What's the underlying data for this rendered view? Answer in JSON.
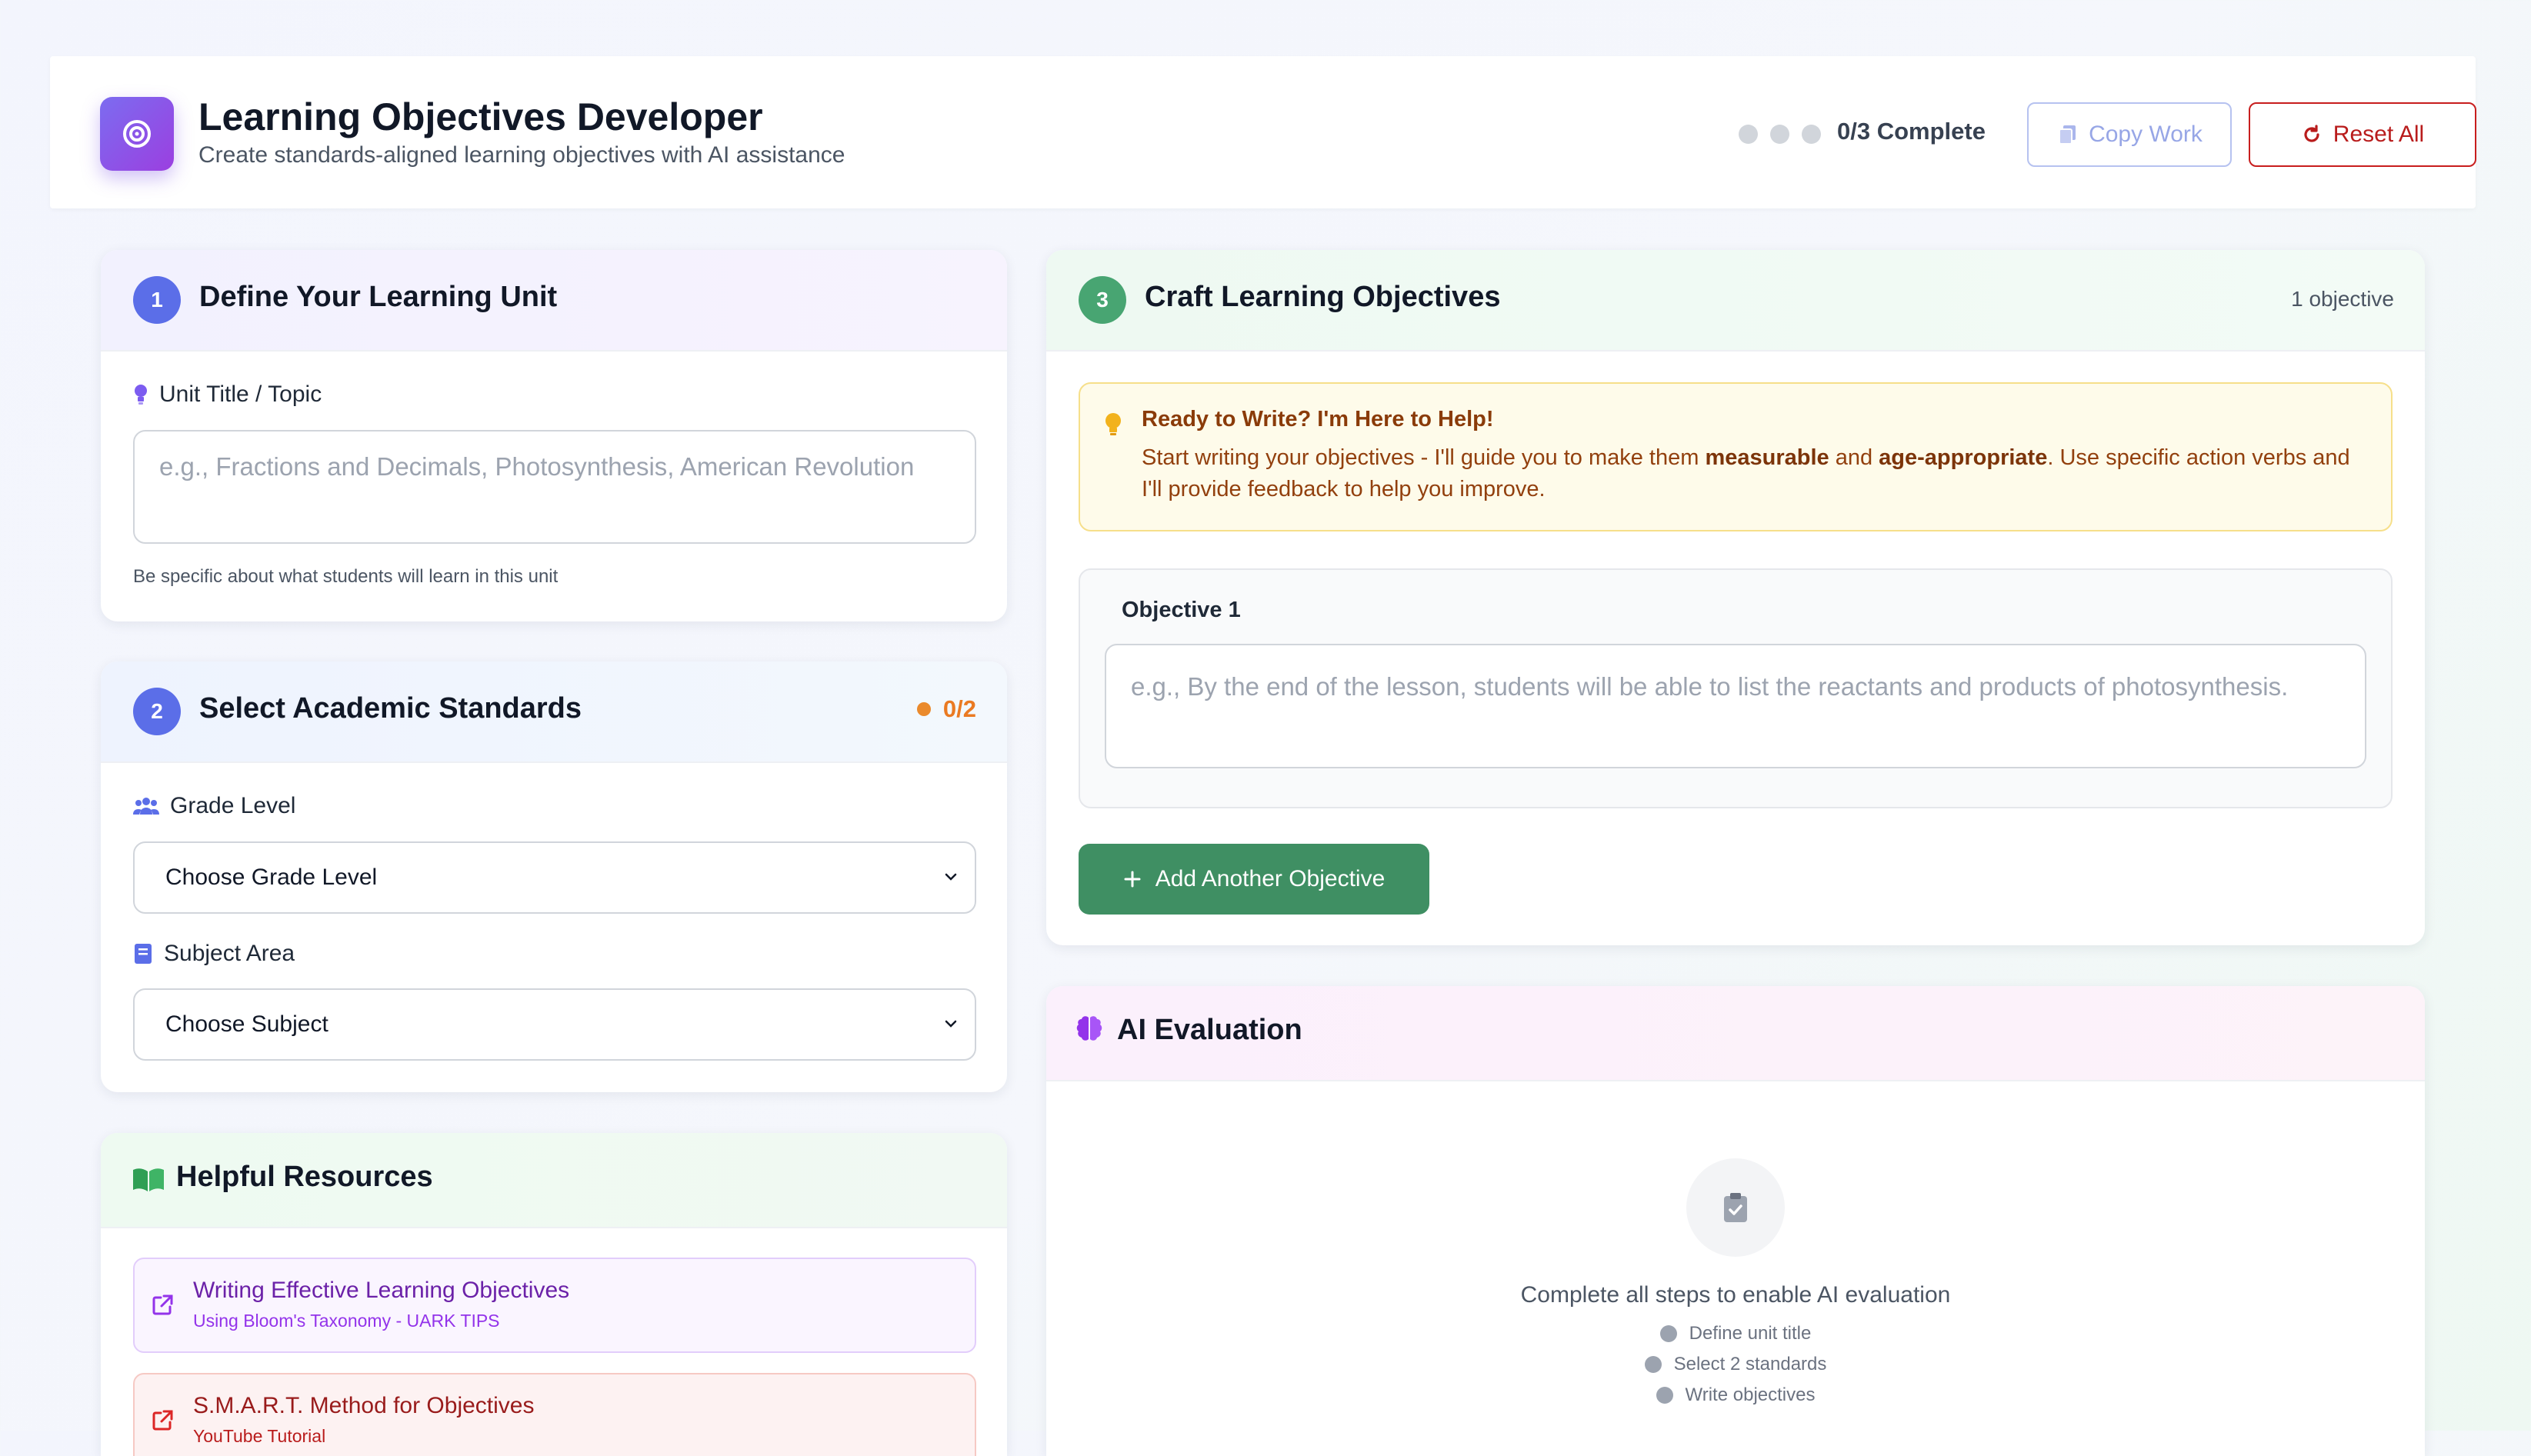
{
  "header": {
    "title": "Learning Objectives Developer",
    "subtitle": "Create standards-aligned learning objectives with AI assistance",
    "progress_label": "0/3 Complete",
    "copy_label": "Copy Work",
    "reset_label": "Reset All",
    "icon": "target-icon"
  },
  "step1": {
    "number": "1",
    "title": "Define Your Learning Unit",
    "field_label": "Unit Title / Topic",
    "placeholder": "e.g., Fractions and Decimals, Photosynthesis, American Revolution",
    "hint": "Be specific about what students will learn in this unit"
  },
  "step2": {
    "number": "2",
    "title": "Select Academic Standards",
    "status": "0/2",
    "grade_label": "Grade Level",
    "grade_value": "Choose Grade Level",
    "subject_label": "Subject Area",
    "subject_value": "Choose Subject"
  },
  "resources": {
    "title": "Helpful Resources",
    "items": [
      {
        "title": "Writing Effective Learning Objectives",
        "subtitle": "Using Bloom's Taxonomy - UARK TIPS"
      },
      {
        "title": "S.M.A.R.T. Method for Objectives",
        "subtitle": "YouTube Tutorial"
      }
    ]
  },
  "step3": {
    "number": "3",
    "title": "Craft Learning Objectives",
    "count": "1 objective",
    "tip_title": "Ready to Write? I'm Here to Help!",
    "tip_part1": "Start writing your objectives - I'll guide you to make them ",
    "tip_bold1": "measurable",
    "tip_part2": " and ",
    "tip_bold2": "age-appropriate",
    "tip_part3": ". Use specific action verbs and I'll provide feedback to help you improve.",
    "objective_label": "Objective 1",
    "objective_placeholder": "e.g., By the end of the lesson, students will be able to list the reactants and products of photosynthesis.",
    "add_label": "Add Another Objective"
  },
  "evaluation": {
    "title": "AI Evaluation",
    "message": "Complete all steps to enable AI evaluation",
    "checklist": [
      "Define unit title",
      "Select 2 standards",
      "Write objectives"
    ]
  },
  "colors": {
    "accent_purple": "#7c3aed",
    "step1_blue": "#5b6ee8",
    "step3_green": "#48a572",
    "primary_green": "#3f8f63",
    "reset_red": "#c81e1e",
    "status_orange": "#ea7a22"
  }
}
